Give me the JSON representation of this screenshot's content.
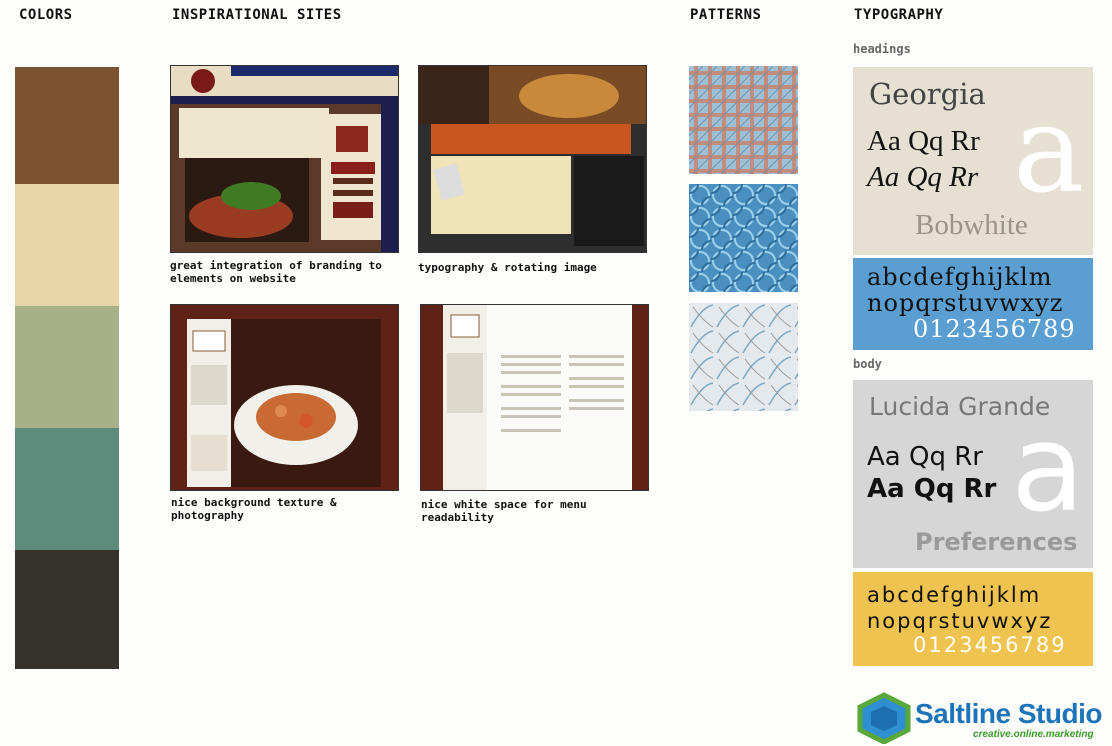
{
  "headers": {
    "colors": "COLORS",
    "sites": "INSPIRATIONAL SITES",
    "patterns": "PATTERNS",
    "typography": "TYPOGRAPHY"
  },
  "colors": [
    "#7d5230",
    "#e9d6a8",
    "#a7b089",
    "#5e8c7c",
    "#35332c"
  ],
  "sites": [
    {
      "caption": "great integration of branding to elements on website"
    },
    {
      "caption": "typography & rotating image"
    },
    {
      "caption": "nice background texture & photography"
    },
    {
      "caption": "nice white space for menu readability"
    }
  ],
  "typography": {
    "headings_label": "headings",
    "body_label": "body",
    "headings": {
      "font_name": "Georgia",
      "sample1": "Aa Qq Rr",
      "sample2": "Aa Qq Rr",
      "big_a": "a",
      "secondary": "Bobwhite",
      "alpha1": "abcdefghijklm",
      "alpha2": "nopqrstuvwxyz",
      "digits": "0123456789"
    },
    "body": {
      "font_name": "Lucida Grande",
      "sample1": "Aa Qq Rr",
      "sample2": "Aa Qq Rr",
      "big_a": "a",
      "secondary": "Preferences",
      "alpha1": "abcdefghijklm",
      "alpha2": "nopqrstuvwxyz",
      "digits": "0123456789"
    }
  },
  "logo": {
    "name": "Saltline Studio",
    "tagline": "creative.online.marketing"
  }
}
